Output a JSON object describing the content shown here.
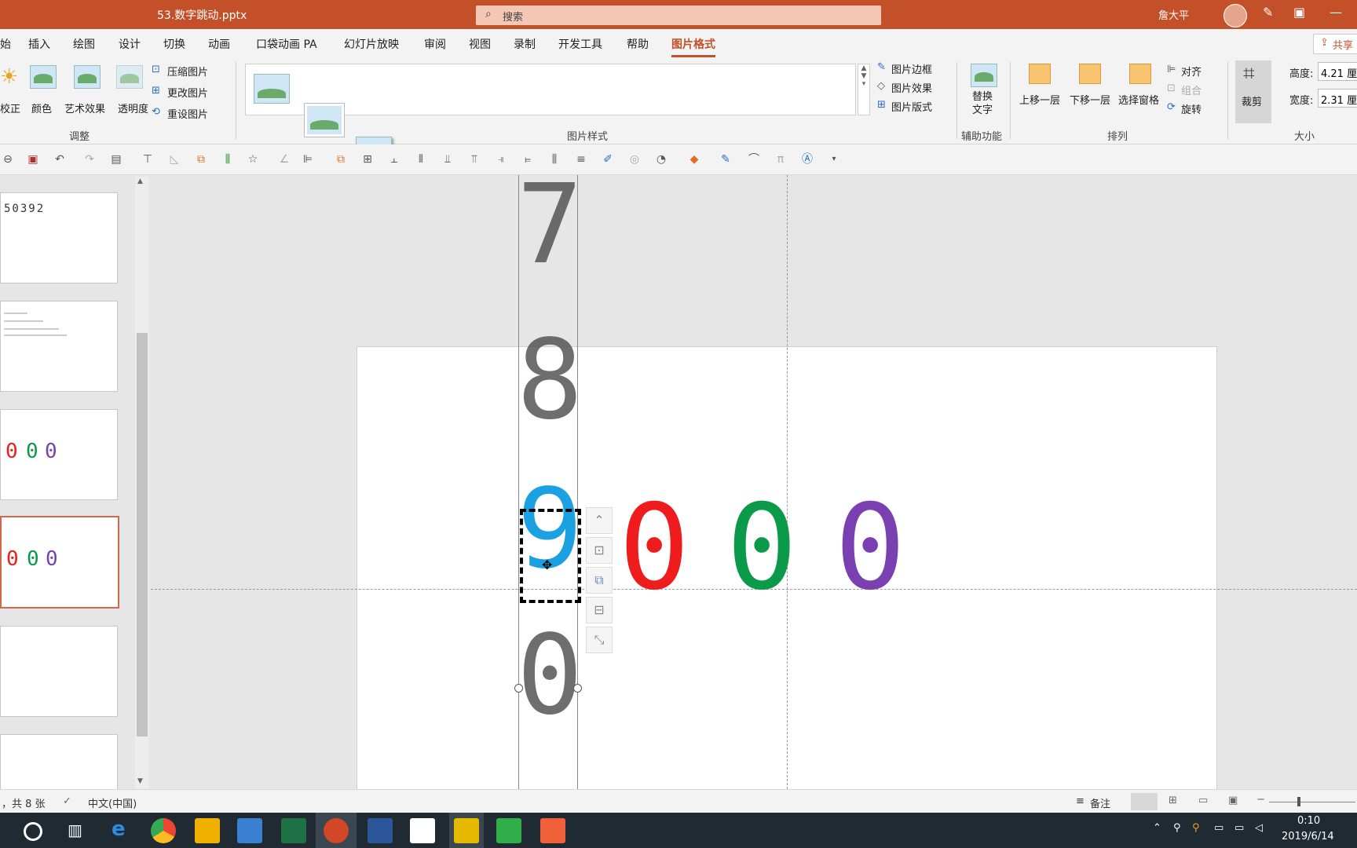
{
  "titlebar": {
    "filename": "53.数字跳动.pptx",
    "search_placeholder": "搜索",
    "user": "詹大平"
  },
  "tabs": [
    "始",
    "插入",
    "绘图",
    "设计",
    "切换",
    "动画",
    "口袋动画 PA",
    "幻灯片放映",
    "审阅",
    "视图",
    "录制",
    "开发工具",
    "帮助",
    "图片格式"
  ],
  "active_tab": "图片格式",
  "share_label": "共享",
  "ribbon": {
    "adjust": {
      "items": [
        "校正",
        "颜色",
        "艺术效果",
        "透明度"
      ],
      "small": [
        "压缩图片",
        "更改图片",
        "重设图片"
      ],
      "group": "调整"
    },
    "styles": {
      "group": "图片样式",
      "side": [
        "图片边框",
        "图片效果",
        "图片版式"
      ]
    },
    "accessibility": {
      "item": "替换\n文字",
      "group": "辅助功能"
    },
    "arrange": {
      "items": [
        "上移一层",
        "下移一层",
        "选择窗格"
      ],
      "small": [
        "对齐",
        "组合",
        "旋转"
      ],
      "group": "排列"
    },
    "size": {
      "crop": "裁剪",
      "height_label": "高度:",
      "height_value": "4.21 厘",
      "width_label": "宽度:",
      "width_value": "2.31 厘",
      "group": "大小"
    }
  },
  "thumbnails": {
    "t1_text": "50392",
    "t3_digits": [
      "0",
      "0",
      "0"
    ],
    "t4_digits": [
      "0",
      "0",
      "0"
    ]
  },
  "slide": {
    "strip_digits": [
      "7",
      "8",
      "9",
      "0"
    ],
    "digits": [
      "0",
      "0",
      "0"
    ],
    "colors": {
      "blue": "#1ba1e2",
      "red": "#ee1c1c",
      "green": "#0a9a4a",
      "purple": "#7a3fb0",
      "gray": "#555555"
    }
  },
  "status": {
    "slide_count": "，共 8 张",
    "language": "中文(中国)",
    "notes": "备注"
  },
  "taskbar": {
    "time": "0:10",
    "date": "2019/6/14"
  }
}
